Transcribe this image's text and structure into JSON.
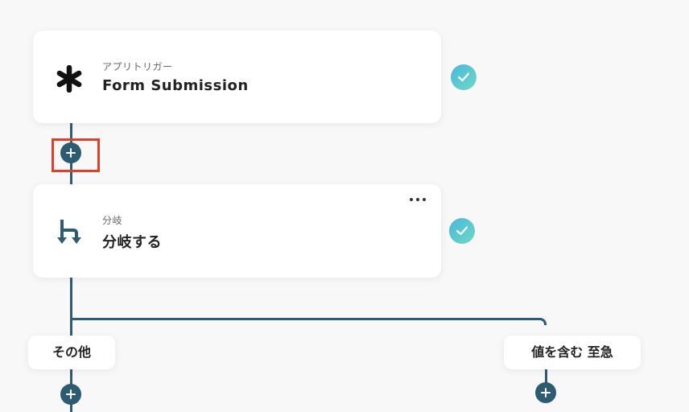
{
  "trigger_card": {
    "subtitle": "アプリトリガー",
    "title": "Form Submission"
  },
  "branch_card": {
    "subtitle": "分岐",
    "title": "分岐する",
    "more_label": "…"
  },
  "branches": {
    "left_label": "その他",
    "right_label": "値を含む 至急"
  },
  "colors": {
    "accent": "#2c5b72",
    "check_gradient_start": "#49b7dc",
    "check_gradient_end": "#6fd9c4",
    "highlight": "#e0402a"
  },
  "icons": {
    "trigger": "asterisk-icon",
    "branch": "branch-icon",
    "status": "check-icon",
    "add": "plus-icon",
    "more": "more-icon"
  }
}
